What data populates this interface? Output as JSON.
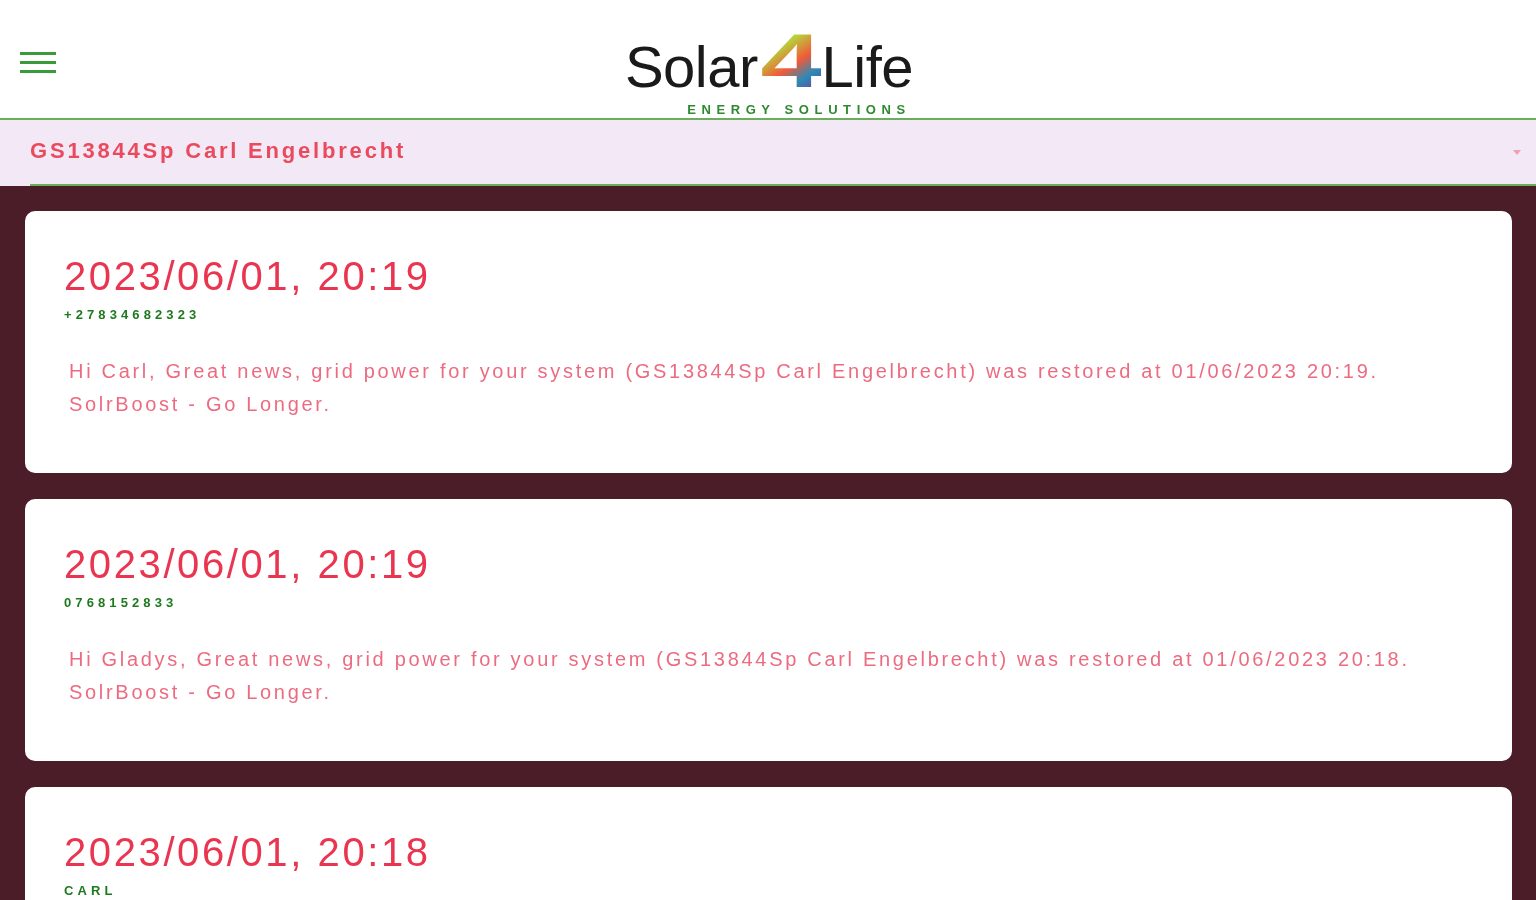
{
  "header": {
    "logo": {
      "name_start": "Solar",
      "name_mark": "4",
      "name_end": "Life",
      "tagline": "ENERGY SOLUTIONS"
    }
  },
  "system_select": {
    "value": "GS13844Sp Carl Engelbrecht"
  },
  "messages": [
    {
      "timestamp": "2023/06/01, 20:19",
      "sender": "+27834682323",
      "text": "Hi Carl, Great news, grid power for your system (GS13844Sp Carl Engelbrecht) was restored at 01/06/2023 20:19.\nSolrBoost - Go Longer."
    },
    {
      "timestamp": "2023/06/01, 20:19",
      "sender": "0768152833",
      "text": "Hi Gladys, Great news, grid power for your system (GS13844Sp Carl Engelbrecht) was restored at 01/06/2023 20:18.\nSolrBoost - Go Longer."
    },
    {
      "timestamp": "2023/06/01, 20:18",
      "sender": "CARL"
    }
  ]
}
